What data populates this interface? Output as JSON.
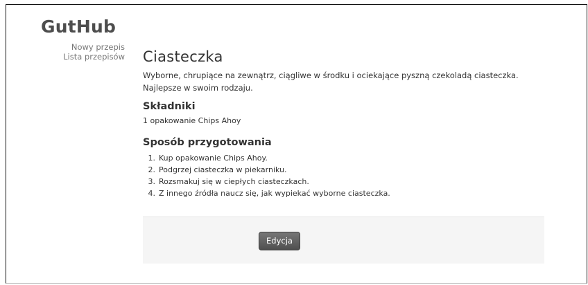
{
  "brand": "GutHub",
  "nav": {
    "items": [
      {
        "label": "Nowy przepis"
      },
      {
        "label": "Lista przepisów"
      }
    ]
  },
  "recipe": {
    "title": "Ciasteczka",
    "description": "Wyborne, chrupiące na zewnątrz, ciągliwe w środku i ociekające pyszną czekoladą ciasteczka. Najlepsze w swoim rodzaju.",
    "ingredients_heading": "Składniki",
    "ingredients": [
      "1 opakowanie Chips Ahoy"
    ],
    "steps_heading": "Sposób przygotowania",
    "steps": [
      {
        "num": "1.",
        "text": "Kup opakowanie Chips Ahoy."
      },
      {
        "num": "2.",
        "text": "Podgrzej ciasteczka w piekarniku."
      },
      {
        "num": "3.",
        "text": "Rozsmakuj się w ciepłych ciasteczkach."
      },
      {
        "num": "4.",
        "text": "Z innego źródła naucz się, jak wypiekać wyborne ciasteczka."
      }
    ]
  },
  "actions": {
    "edit_label": "Edycja"
  }
}
